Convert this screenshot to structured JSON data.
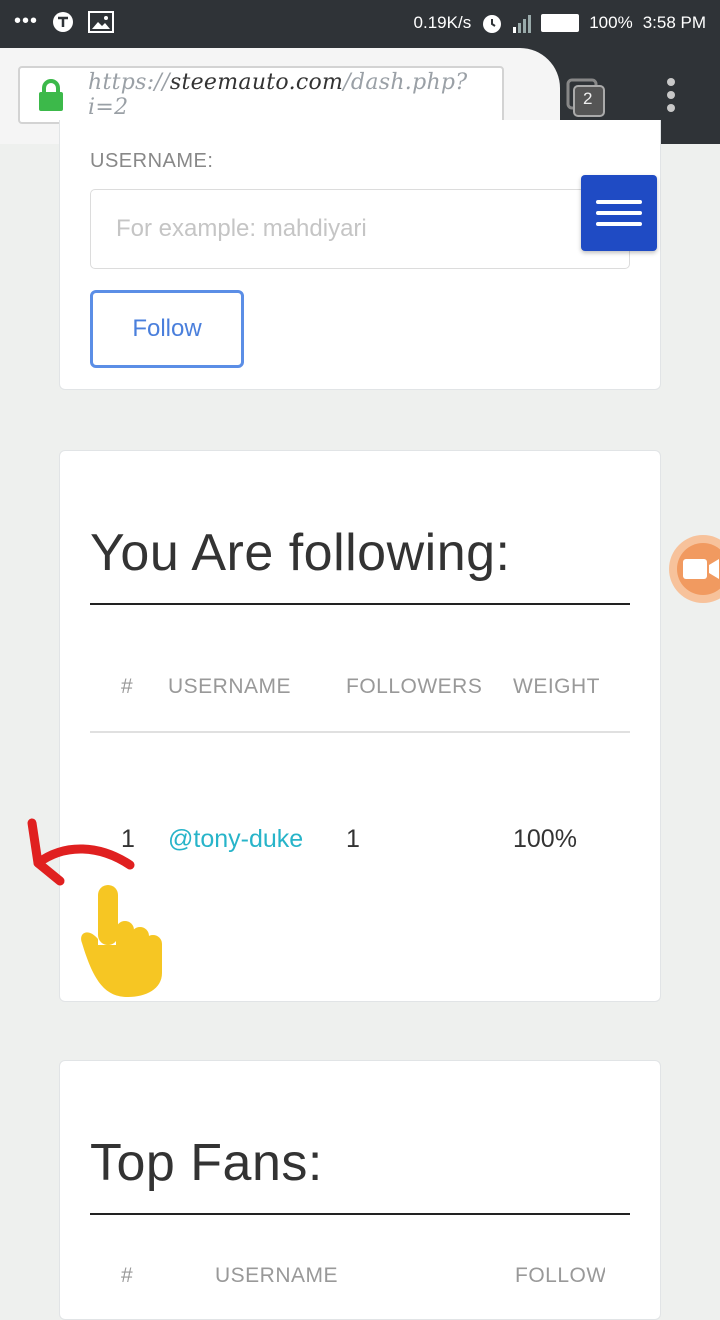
{
  "status_bar": {
    "net_speed": "0.19K/s",
    "battery": "100%",
    "time": "3:58 PM",
    "icons": [
      "more-icon",
      "vpn-icon",
      "image-icon",
      "alarm-icon",
      "signal-icon",
      "battery-icon"
    ]
  },
  "browser": {
    "url_prefix": "https://",
    "url_domain": "steemauto.com",
    "url_path": "/dash.php?i=2",
    "tab_count": "2"
  },
  "follow_form": {
    "label": "USERNAME:",
    "placeholder": "For example: mahdiyari",
    "button": "Follow"
  },
  "following": {
    "title": "You Are following:",
    "columns": [
      "#",
      "USERNAME",
      "FOLLOWERS",
      "WEIGHT"
    ],
    "rows": [
      {
        "num": "1",
        "username": "@tony-duke",
        "followers": "1",
        "weight": "100%"
      }
    ]
  },
  "top_fans": {
    "title": "Top Fans:",
    "columns": [
      "#",
      "USERNAME",
      "FOLLOWERS"
    ]
  },
  "colors": {
    "accent": "#1f4bc4",
    "link": "#27b4c9",
    "follow_border": "#5b8ee6",
    "annotation_arrow": "#e02020"
  }
}
